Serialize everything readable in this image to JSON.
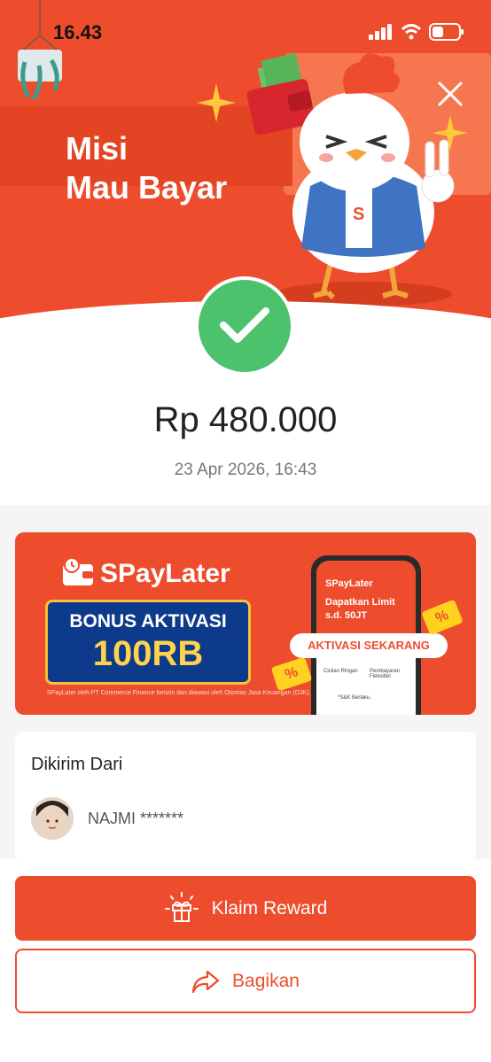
{
  "status_bar": {
    "time": "16.43",
    "icons": [
      "signal-icon",
      "wifi-icon",
      "battery-icon"
    ]
  },
  "hero": {
    "title_line1": "Misi",
    "title_line2": "Mau Bayar",
    "background_color": "#ee4d2d"
  },
  "transaction": {
    "amount": "Rp 480.000",
    "datetime": "23 Apr 2026, 16:43",
    "status_icon": "check-icon",
    "status_color": "#4bc26b"
  },
  "promo": {
    "brand": "SPayLater",
    "bonus_line1": "BONUS AKTIVASI",
    "bonus_line2": "100RB",
    "cta": "AKTIVASI SEKARANG",
    "phone_brand": "SPayLater",
    "phone_limit_line1": "Dapatkan Limit",
    "phone_limit_line2": "s.d. 50JT",
    "phone_item1": "Cicilan Ringan",
    "phone_item2": "Pembayaran Fleksibel",
    "phone_terms": "*S&K Berlaku.",
    "fine_print": "SPayLater oleh PT Commerce Finance berizin dan diawasi oleh Otoritas Jasa Keuangan (OJK)."
  },
  "sender": {
    "title": "Dikirim Dari",
    "name": "NAJMI *******"
  },
  "actions": {
    "primary_label": "Klaim Reward",
    "secondary_label": "Bagikan",
    "accent_color": "#ee4d2d"
  }
}
